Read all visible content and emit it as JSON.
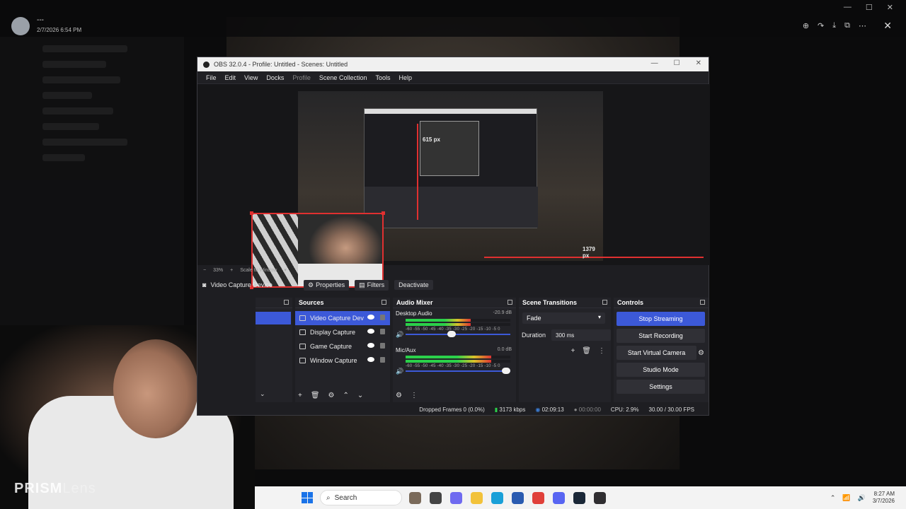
{
  "viewer": {
    "user": "---",
    "date": "2/7/2026 6:54 PM",
    "tools": [
      "zoom-in-icon",
      "rotate-icon",
      "download-icon",
      "open-external-icon",
      "more-icon"
    ]
  },
  "obs": {
    "title": "OBS 32.0.4 - Profile: Untitled - Scenes: Untitled",
    "menu": [
      "File",
      "Edit",
      "View",
      "Docks",
      "Profile",
      "Scene Collection",
      "Tools",
      "Help"
    ],
    "guide_v_label": "615 px",
    "guide_h_label": "1379 px",
    "zoom": "33%",
    "scale_mode": "Scale to Window",
    "context": {
      "source": "Video Capture Device",
      "properties": "Properties",
      "filters": "Filters",
      "deactivate": "Deactivate"
    },
    "sources_title": "Sources",
    "sources": [
      {
        "name": "Video Capture Dev",
        "icon": "camera-icon"
      },
      {
        "name": "Display Capture",
        "icon": "monitor-icon"
      },
      {
        "name": "Game Capture",
        "icon": "gamepad-icon"
      },
      {
        "name": "Window Capture",
        "icon": "window-icon"
      }
    ],
    "mixer_title": "Audio Mixer",
    "channels": [
      {
        "name": "Desktop Audio",
        "db": "-20.9 dB",
        "level": 0.62,
        "volume": 0.48
      },
      {
        "name": "Mic/Aux",
        "db": "0.0 dB",
        "level": 0.82,
        "volume": 1.0
      }
    ],
    "meter_ticks": "-60 -55 -50 -45 -40 -35 -30 -25 -20 -15 -10 -5 0",
    "transitions_title": "Scene Transitions",
    "transition": "Fade",
    "duration_label": "Duration",
    "duration": "300 ms",
    "controls_title": "Controls",
    "controls": {
      "stop_streaming": "Stop Streaming",
      "start_recording": "Start Recording",
      "start_virtual_camera": "Start Virtual Camera",
      "studio_mode": "Studio Mode",
      "settings": "Settings"
    },
    "status": {
      "dropped": "Dropped Frames 0 (0.0%)",
      "bitrate": "3173 kbps",
      "stream_time": "02:09:13",
      "rec_time": "00:00:00",
      "cpu": "CPU: 2.9%",
      "fps": "30.00 / 30.00 FPS"
    }
  },
  "watermark": {
    "bold": "PRISM",
    "light": "Lens"
  },
  "taskbar": {
    "search": "Search",
    "time": "8:27 AM",
    "date": "3/7/2026"
  }
}
